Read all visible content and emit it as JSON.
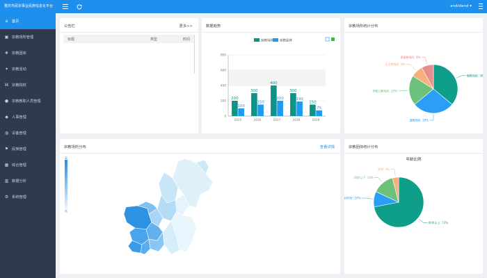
{
  "app": {
    "title": "重庆市民宗事业民族信息化平台"
  },
  "sidebar": {
    "items": [
      {
        "label": "首页",
        "icon": "home-icon",
        "active": true
      },
      {
        "label": "宗教场所管理",
        "icon": "building-icon"
      },
      {
        "label": "宗教团体",
        "icon": "group-icon"
      },
      {
        "label": "宗教活动",
        "icon": "activity-icon"
      },
      {
        "label": "宗教院校",
        "icon": "school-icon"
      },
      {
        "label": "宗教教职人员管理",
        "icon": "person-icon"
      },
      {
        "label": "人事管理",
        "icon": "staff-icon"
      },
      {
        "label": "设备管理",
        "icon": "device-icon"
      },
      {
        "label": "民族管理",
        "icon": "flag-icon"
      },
      {
        "label": "综合管理",
        "icon": "grid-icon"
      },
      {
        "label": "数据分析",
        "icon": "chart-icon"
      },
      {
        "label": "系统管理",
        "icon": "gear-icon"
      }
    ]
  },
  "topbar": {
    "user": "andrdand"
  },
  "notice": {
    "title": "公告栏",
    "more": "更多>>",
    "columns": [
      "标题",
      "类型",
      "时间"
    ]
  },
  "bar_card": {
    "title": "数据趋势"
  },
  "pie_card": {
    "title": "宗教场所统计分布"
  },
  "map_card": {
    "title": "宗教场所分布",
    "more": "查看详情"
  },
  "donut_card": {
    "title": "宗教团体统计分布"
  },
  "chart_data": [
    {
      "type": "bar",
      "categories": [
        "2015",
        "2016",
        "2017",
        "2018",
        "2019"
      ],
      "series": [
        {
          "name": "宗教场所",
          "values": [
            200,
            300,
            400,
            300,
            150
          ]
        },
        {
          "name": "宗教团体",
          "values": [
            100,
            150,
            200,
            190,
            75
          ]
        }
      ],
      "ylim": [
        0,
        800
      ],
      "yticks": [
        0,
        200,
        400,
        600,
        800
      ],
      "colors": [
        "#0d9488",
        "#1e9bf0"
      ],
      "grid": true,
      "legend": "top"
    },
    {
      "type": "pie",
      "labels": [
        "佛教场所",
        "道教场所",
        "伊斯兰教场所",
        "天主教场所",
        "基督教场所"
      ],
      "values": [
        36,
        28,
        20,
        8,
        8
      ],
      "colors": [
        "#0e9e8a",
        "#2a9ff5",
        "#6cc27a",
        "#f6b07b",
        "#e78e8e"
      ]
    },
    {
      "type": "pie",
      "title": "年龄比例",
      "labels": [
        "40岁以上",
        "30岁到40岁",
        "30岁以下",
        "其他"
      ],
      "values": [
        72,
        10,
        14,
        4
      ],
      "colors": [
        "#0e9e8a",
        "#2a9ff5",
        "#6cc27a",
        "#f6b07b"
      ]
    }
  ],
  "map_legend": {
    "max": "高",
    "min": "低"
  },
  "colors": {
    "primary": "#1e8fec",
    "sidebar": "#2f3a4f",
    "teal": "#0e9e8a"
  }
}
